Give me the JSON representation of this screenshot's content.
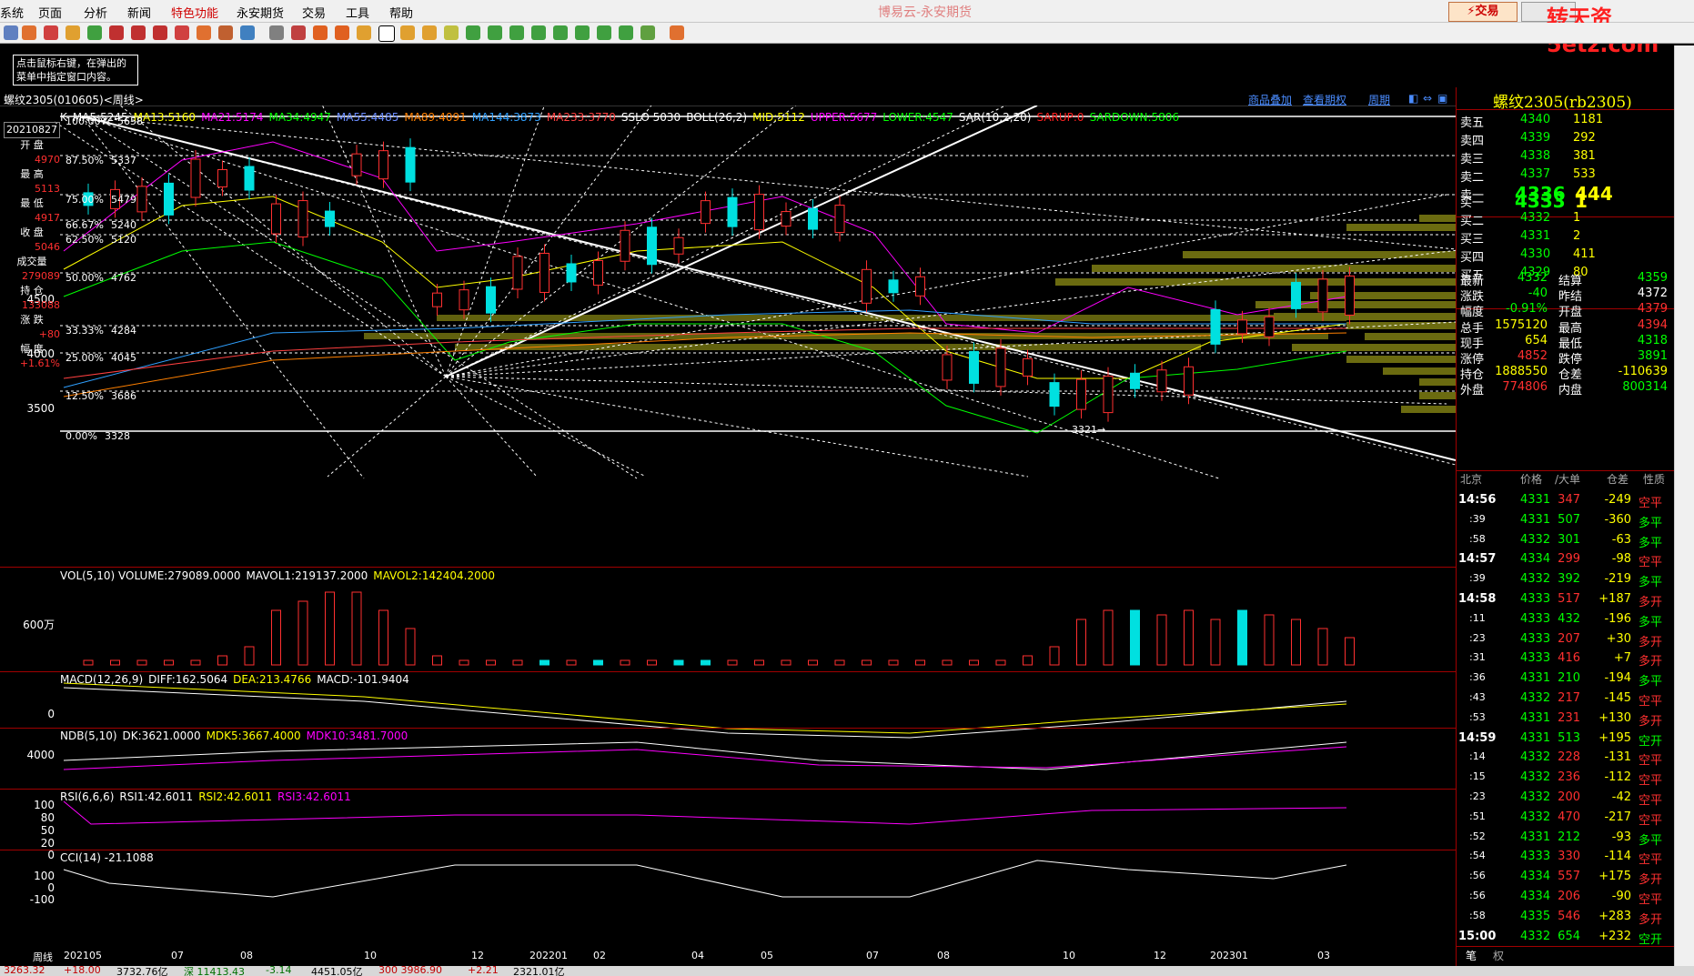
{
  "menu": {
    "items": [
      "系统",
      "页面",
      "分析",
      "新闻",
      "特色功能",
      "永安期货",
      "交易",
      "工具",
      "帮助"
    ],
    "app_title": "博易云-永安期货",
    "trade_button": "⚡交易",
    "watermark": "转天资5etz.com"
  },
  "tip": "点击鼠标右键，在弹出的菜单中指定窗口内容。",
  "chart_header": {
    "symbol": "螺纹2305(010605)<周线>",
    "links": [
      "商品叠加",
      "查看期权",
      "周期"
    ]
  },
  "main_indicators": [
    {
      "text": "K",
      "color": "#ffffff"
    },
    {
      "text": "MA5:5245",
      "color": "#ffffff"
    },
    {
      "text": "MA13:5160",
      "color": "#ffff00"
    },
    {
      "text": "MA21:5174",
      "color": "#ff00ff"
    },
    {
      "text": "MA34:4947",
      "color": "#00ff00"
    },
    {
      "text": "MA55:4485",
      "color": "#6a8cff"
    },
    {
      "text": "MA89:4091",
      "color": "#ff8000"
    },
    {
      "text": "MA144:3873",
      "color": "#2fa0ff"
    },
    {
      "text": "MA233:3770",
      "color": "#ff4040"
    },
    {
      "text": "SSLO 5030",
      "color": "#ffffff"
    },
    {
      "text": "BOLL(26,2)",
      "color": "#ffffff"
    },
    {
      "text": "MID:5112",
      "color": "#ffff00"
    },
    {
      "text": "UPPER:5677",
      "color": "#ff00ff"
    },
    {
      "text": "LOWER:4547",
      "color": "#00ff00"
    },
    {
      "text": "SAR(10,2,20)",
      "color": "#ffffff"
    },
    {
      "text": "SARUP:0",
      "color": "#ff2020"
    },
    {
      "text": "SARDOWN:5806",
      "color": "#00ff00"
    }
  ],
  "info_panel": {
    "date": "20210827",
    "rows": [
      {
        "label": "开 盘",
        "value": "4970"
      },
      {
        "label": "最 高",
        "value": "5113"
      },
      {
        "label": "最 低",
        "value": "4917"
      },
      {
        "label": "收 盘",
        "value": "5046"
      },
      {
        "label": "成交量",
        "value": "279089"
      },
      {
        "label": "持 仓",
        "value": "133088"
      },
      {
        "label": "涨 跌",
        "value": "+80"
      },
      {
        "label": "幅 度",
        "value": "+1.61%"
      }
    ]
  },
  "fib_levels": [
    {
      "label": "100.00%",
      "price": "5658"
    },
    {
      "label": "87.50%",
      "price": "5337"
    },
    {
      "label": "75.00%",
      "price": "5479"
    },
    {
      "label": "66.67%",
      "price": "5240"
    },
    {
      "label": "62.50%",
      "price": "5120"
    },
    {
      "label": "50.00%",
      "price": "4762"
    },
    {
      "label": "33.33%",
      "price": "4284"
    },
    {
      "label": "25.00%",
      "price": "4045"
    },
    {
      "label": "12.50%",
      "price": "3686"
    },
    {
      "label": "0.00%",
      "price": "3328"
    }
  ],
  "price_axis": [
    "4500",
    "4000",
    "3500"
  ],
  "low_mark": "3321→",
  "volume": {
    "indicators": [
      {
        "text": "VOL(5,10) VOLUME:279089.0000",
        "color": "#ffffff"
      },
      {
        "text": "MAVOL1:219137.2000",
        "color": "#ffffff"
      },
      {
        "text": "MAVOL2:142404.2000",
        "color": "#ffff00"
      }
    ],
    "axis_label": "600万"
  },
  "macd": {
    "indicators": [
      {
        "text": "MACD(12,26,9)",
        "color": "#ffffff"
      },
      {
        "text": "DIFF:162.5064",
        "color": "#ffffff"
      },
      {
        "text": "DEA:213.4766",
        "color": "#ffff00"
      },
      {
        "text": "MACD:-101.9404",
        "color": "#ffffff"
      }
    ],
    "axis_label": "0"
  },
  "ndb": {
    "indicators": [
      {
        "text": "NDB(5,10)",
        "color": "#ffffff"
      },
      {
        "text": "DK:3621.0000",
        "color": "#ffffff"
      },
      {
        "text": "MDK5:3667.4000",
        "color": "#ffff00"
      },
      {
        "text": "MDK10:3481.7000",
        "color": "#ff00ff"
      }
    ],
    "axis_label": "4000"
  },
  "rsi": {
    "indicators": [
      {
        "text": "RSI(6,6,6)",
        "color": "#ffffff"
      },
      {
        "text": "RSI1:42.6011",
        "color": "#ffffff"
      },
      {
        "text": "RSI2:42.6011",
        "color": "#ffff00"
      },
      {
        "text": "RSI3:42.6011",
        "color": "#ff00ff"
      }
    ],
    "axis_labels": [
      "100",
      "80",
      "50",
      "20",
      "0"
    ]
  },
  "cci": {
    "indicators": [
      {
        "text": "CCI(14) -21.1088",
        "color": "#ffffff"
      }
    ],
    "axis_labels": [
      "100",
      "0",
      "-100"
    ]
  },
  "x_axis": {
    "period_label": "周线",
    "ticks": [
      "202105",
      "07",
      "08",
      "10",
      "12",
      "202201",
      "02",
      "04",
      "05",
      "07",
      "08",
      "10",
      "12",
      "202301",
      "03"
    ]
  },
  "quote": {
    "title": "螺纹2305(rb2305)",
    "asks": [
      {
        "label": "卖五",
        "price": "4340",
        "vol": "1181"
      },
      {
        "label": "卖四",
        "price": "4339",
        "vol": "292"
      },
      {
        "label": "卖三",
        "price": "4338",
        "vol": "381"
      },
      {
        "label": "卖二",
        "price": "4337",
        "vol": "533"
      },
      {
        "label": "卖一",
        "price": "4336",
        "vol": "444"
      }
    ],
    "bids": [
      {
        "label": "买一",
        "price": "4333",
        "vol": "1"
      },
      {
        "label": "买二",
        "price": "4332",
        "vol": "1"
      },
      {
        "label": "买三",
        "price": "4331",
        "vol": "2"
      },
      {
        "label": "买四",
        "price": "4330",
        "vol": "411"
      },
      {
        "label": "买五",
        "price": "4329",
        "vol": "80"
      }
    ],
    "stats": [
      {
        "l1": "最新",
        "v1": "4332",
        "c1": "#00ff00",
        "l2": "结算",
        "v2": "4359",
        "c2": "#00ff00"
      },
      {
        "l1": "涨跌",
        "v1": "-40",
        "c1": "#00ff00",
        "l2": "昨结",
        "v2": "4372",
        "c2": "#ffffff"
      },
      {
        "l1": "幅度",
        "v1": "-0.91%",
        "c1": "#00ff00",
        "l2": "开盘",
        "v2": "4379",
        "c2": "#ff3030"
      },
      {
        "l1": "总手",
        "v1": "1575120",
        "c1": "#ffff00",
        "l2": "最高",
        "v2": "4394",
        "c2": "#ff3030"
      },
      {
        "l1": "现手",
        "v1": "654",
        "c1": "#ffff00",
        "l2": "最低",
        "v2": "4318",
        "c2": "#00ff00"
      },
      {
        "l1": "涨停",
        "v1": "4852",
        "c1": "#ff3030",
        "l2": "跌停",
        "v2": "3891",
        "c2": "#00ff00"
      },
      {
        "l1": "持仓",
        "v1": "1888550",
        "c1": "#ffff00",
        "l2": "仓差",
        "v2": "-110639",
        "c2": "#ffff00"
      },
      {
        "l1": "外盘",
        "v1": "774806",
        "c1": "#ff3030",
        "l2": "内盘",
        "v2": "800314",
        "c2": "#00ff00"
      }
    ],
    "ticks_header": [
      "北京",
      "价格",
      "/大单",
      "仓差",
      "性质"
    ],
    "ticks": [
      {
        "time": "14:56",
        "price": "4331",
        "vol": "347",
        "diff": "-249",
        "kind": "空平",
        "vc": "#ff3030",
        "kc": "#ff3030"
      },
      {
        "time": ":39",
        "price": "4331",
        "vol": "507",
        "diff": "-360",
        "kind": "多平",
        "vc": "#00ff00",
        "kc": "#00ff00"
      },
      {
        "time": ":58",
        "price": "4332",
        "vol": "301",
        "diff": "-63",
        "kind": "多平",
        "vc": "#00ff00",
        "kc": "#00ff00"
      },
      {
        "time": "14:57",
        "price": "4334",
        "vol": "299",
        "diff": "-98",
        "kind": "空平",
        "vc": "#ff3030",
        "kc": "#ff3030"
      },
      {
        "time": ":39",
        "price": "4332",
        "vol": "392",
        "diff": "-219",
        "kind": "多平",
        "vc": "#00ff00",
        "kc": "#00ff00"
      },
      {
        "time": "14:58",
        "price": "4333",
        "vol": "517",
        "diff": "+187",
        "kind": "多开",
        "vc": "#ff3030",
        "kc": "#ff3030"
      },
      {
        "time": ":11",
        "price": "4333",
        "vol": "432",
        "diff": "-196",
        "kind": "多平",
        "vc": "#00ff00",
        "kc": "#00ff00"
      },
      {
        "time": ":23",
        "price": "4333",
        "vol": "207",
        "diff": "+30",
        "kind": "多开",
        "vc": "#ff3030",
        "kc": "#ff3030"
      },
      {
        "time": ":31",
        "price": "4333",
        "vol": "416",
        "diff": "+7",
        "kind": "多开",
        "vc": "#ff3030",
        "kc": "#ff3030"
      },
      {
        "time": ":36",
        "price": "4331",
        "vol": "210",
        "diff": "-194",
        "kind": "多平",
        "vc": "#00ff00",
        "kc": "#00ff00"
      },
      {
        "time": ":43",
        "price": "4332",
        "vol": "217",
        "diff": "-145",
        "kind": "空平",
        "vc": "#ff3030",
        "kc": "#ff3030"
      },
      {
        "time": ":53",
        "price": "4331",
        "vol": "231",
        "diff": "+130",
        "kind": "多开",
        "vc": "#ff3030",
        "kc": "#ff3030"
      },
      {
        "time": "14:59",
        "price": "4331",
        "vol": "513",
        "diff": "+195",
        "kind": "空开",
        "vc": "#00ff00",
        "kc": "#00ff00"
      },
      {
        "time": ":14",
        "price": "4332",
        "vol": "228",
        "diff": "-131",
        "kind": "空平",
        "vc": "#ff3030",
        "kc": "#ff3030"
      },
      {
        "time": ":15",
        "price": "4332",
        "vol": "236",
        "diff": "-112",
        "kind": "空平",
        "vc": "#ff3030",
        "kc": "#ff3030"
      },
      {
        "time": ":23",
        "price": "4332",
        "vol": "200",
        "diff": "-42",
        "kind": "空平",
        "vc": "#ff3030",
        "kc": "#ff3030"
      },
      {
        "time": ":51",
        "price": "4332",
        "vol": "470",
        "diff": "-217",
        "kind": "空平",
        "vc": "#ff3030",
        "kc": "#ff3030"
      },
      {
        "time": ":52",
        "price": "4331",
        "vol": "212",
        "diff": "-93",
        "kind": "多平",
        "vc": "#00ff00",
        "kc": "#00ff00"
      },
      {
        "time": ":54",
        "price": "4333",
        "vol": "330",
        "diff": "-114",
        "kind": "空平",
        "vc": "#ff3030",
        "kc": "#ff3030"
      },
      {
        "time": ":56",
        "price": "4334",
        "vol": "557",
        "diff": "+175",
        "kind": "多开",
        "vc": "#ff3030",
        "kc": "#ff3030"
      },
      {
        "time": ":56",
        "price": "4334",
        "vol": "206",
        "diff": "-90",
        "kind": "空平",
        "vc": "#ff3030",
        "kc": "#ff3030"
      },
      {
        "time": ":58",
        "price": "4335",
        "vol": "546",
        "diff": "+283",
        "kind": "多开",
        "vc": "#ff3030",
        "kc": "#ff3030"
      },
      {
        "time": "15:00",
        "price": "4332",
        "vol": "654",
        "diff": "+232",
        "kind": "空开",
        "vc": "#00ff00",
        "kc": "#00ff00"
      }
    ],
    "tabs": [
      "笔",
      "权"
    ]
  },
  "status": [
    {
      "text": "3263.32",
      "color": "#c00000"
    },
    {
      "text": "+18.00",
      "color": "#c00000"
    },
    {
      "text": "3732.76亿",
      "color": "#000000"
    },
    {
      "text": "深 11413.43",
      "color": "#007000"
    },
    {
      "text": "-3.14",
      "color": "#007000"
    },
    {
      "text": "4451.05亿",
      "color": "#000000"
    },
    {
      "text": "300 3986.90",
      "color": "#c00000"
    },
    {
      "text": "+2.21",
      "color": "#c00000"
    },
    {
      "text": "2321.01亿",
      "color": "#000000"
    }
  ],
  "chart_data": {
    "type": "candlestick",
    "series_note": "",
    "x": [
      "202105",
      "07",
      "08",
      "10",
      "12",
      "202201",
      "02",
      "04",
      "05",
      "07",
      "08",
      "10",
      "12",
      "202301",
      "03"
    ],
    "approx_close": [
      5046,
      5200,
      4900,
      5300,
      4300,
      4500,
      4700,
      4950,
      4900,
      4400,
      3800,
      3600,
      3700,
      4100,
      4332
    ],
    "ylim": [
      3300,
      5700
    ]
  }
}
